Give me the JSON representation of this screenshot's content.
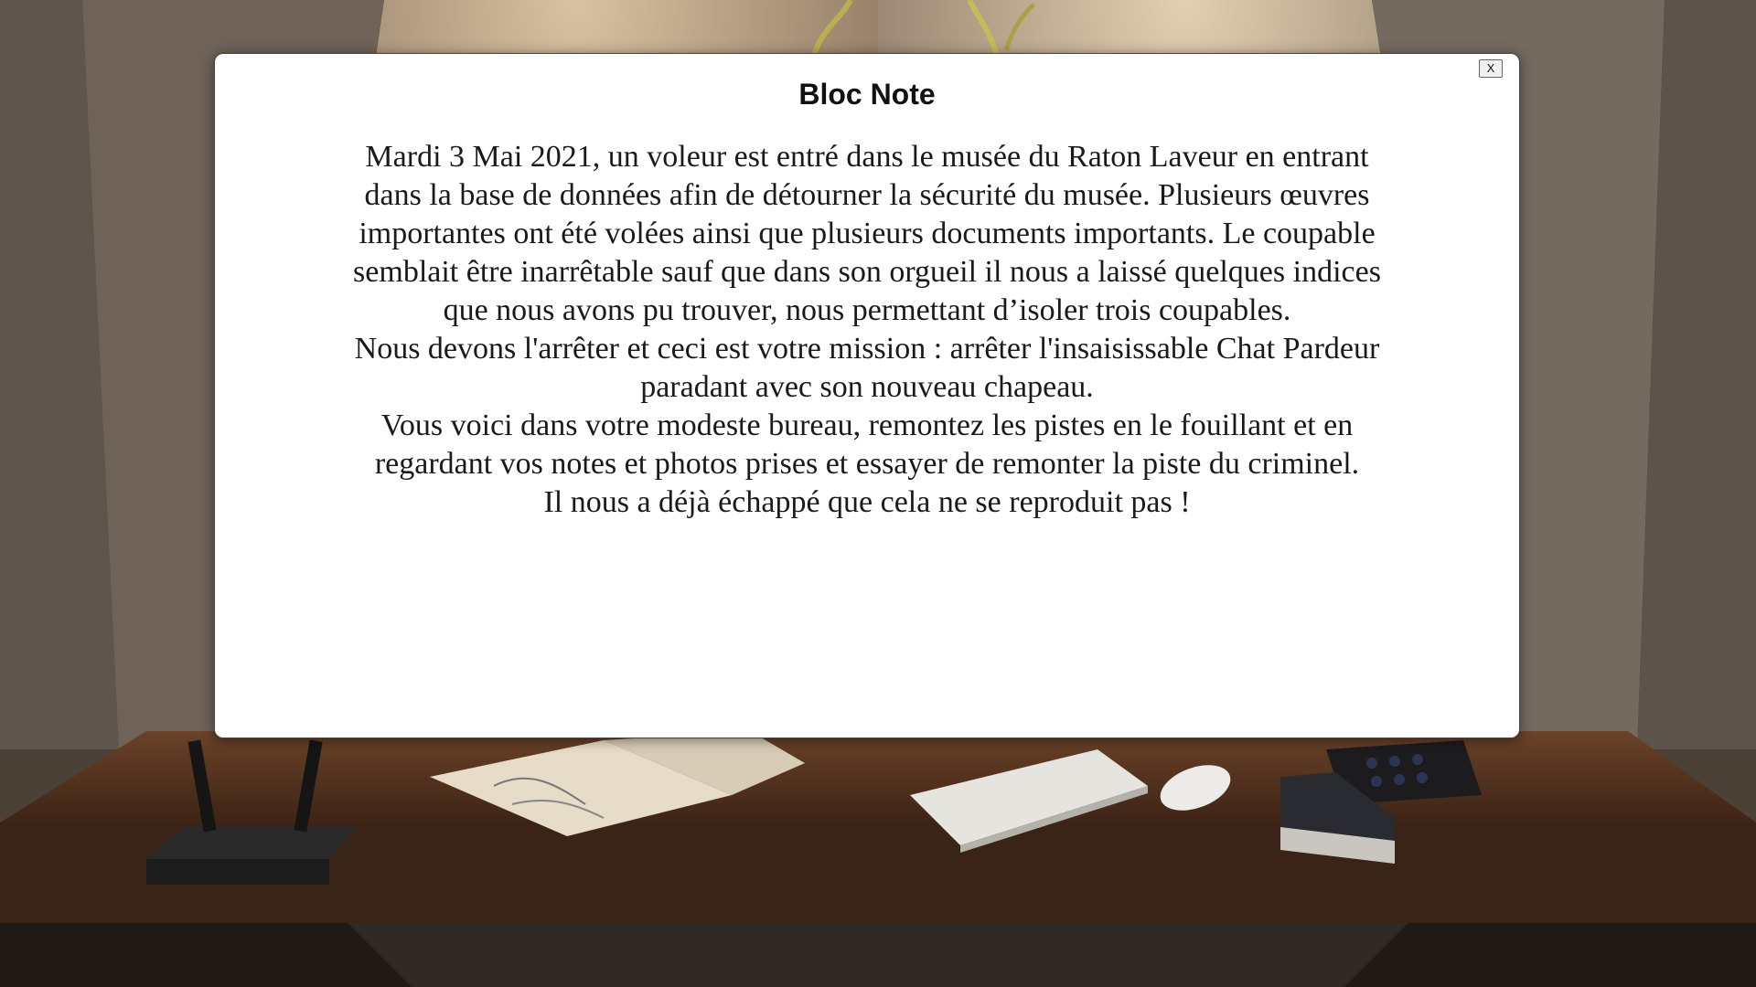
{
  "colors": {
    "wall": "#5a4e43",
    "desk": "#4a2a18",
    "modal_bg": "#ffffff"
  },
  "scene": {
    "objects": [
      "wifi-router",
      "sketchbook",
      "keyboard",
      "mouse",
      "telephone",
      "book",
      "plant",
      "lamp-light"
    ]
  },
  "modal": {
    "title": "Bloc Note",
    "close_label": "X",
    "paragraphs": [
      "Mardi 3 Mai 2021, un voleur est entré dans le musée du Raton Laveur en entrant dans la base de données afin de détourner la sécurité du musée. Plusieurs œuvres importantes ont été volées ainsi que plusieurs documents importants. Le coupable semblait être inarrêtable sauf que dans son orgueil il nous a laissé quelques indices que nous avons pu trouver, nous permettant d’isoler trois coupables.",
      "Nous devons l'arrêter et ceci est votre mission : arrêter l'insaisissable Chat Pardeur paradant avec son nouveau chapeau.",
      "Vous voici dans votre modeste bureau, remontez les pistes en le fouillant et en regardant vos notes et photos prises et essayer de remonter la piste du criminel.",
      "Il nous a déjà échappé que cela ne se reproduit pas !"
    ]
  }
}
